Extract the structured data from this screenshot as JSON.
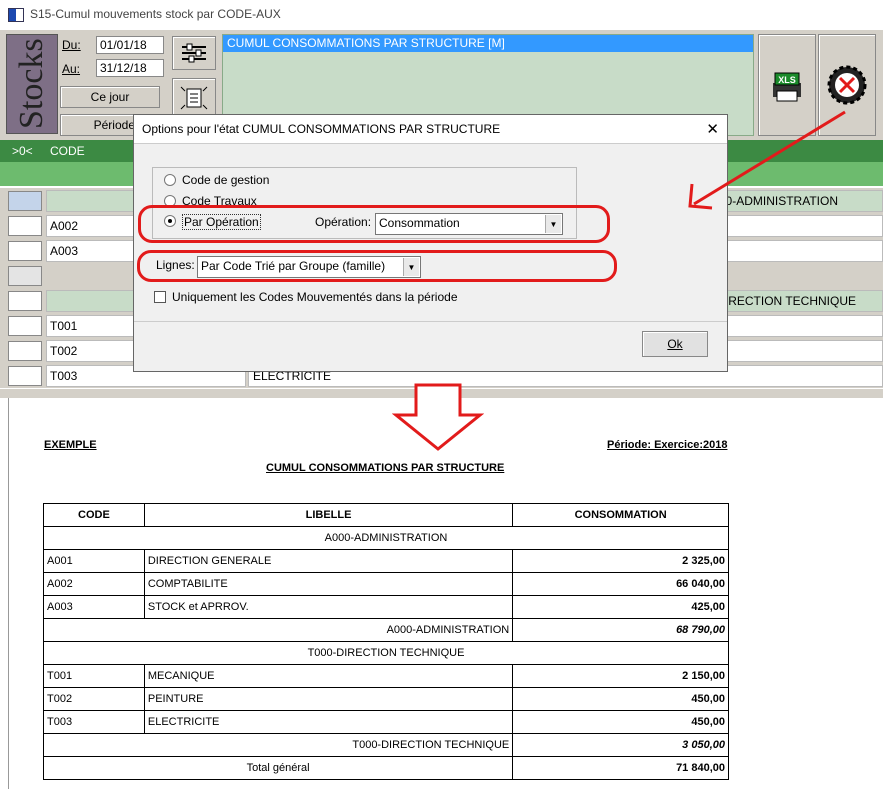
{
  "window": {
    "title": "S15-Cumul mouvements stock par CODE-AUX"
  },
  "toolbar": {
    "stocks_label": "Stocks",
    "du_label": "Du:",
    "du_value": "01/01/18",
    "au_label": "Au:",
    "au_value": "31/12/18",
    "ce_jour": "Ce jour",
    "periode": "Période",
    "selected_state": "CUMUL CONSOMMATIONS PAR STRUCTURE   [M]",
    "xls_label": "XLS"
  },
  "grid": {
    "header_toggle": ">0<",
    "header_code": "CODE",
    "rows": [
      {
        "code": "",
        "libelle": "A000-ADMINISTRATION",
        "group": true
      },
      {
        "code": "A002",
        "libelle": "",
        "group": false
      },
      {
        "code": "A003",
        "libelle": "",
        "group": false
      },
      {
        "code": "",
        "libelle": "",
        "group": false
      },
      {
        "code": "",
        "libelle": "T000-DIRECTION TECHNIQUE",
        "group": true
      },
      {
        "code": "T001",
        "libelle": "",
        "group": false
      },
      {
        "code": "T002",
        "libelle": "",
        "group": false
      },
      {
        "code": "T003",
        "libelle": "ELECTRICITE",
        "group": false
      }
    ]
  },
  "dialog": {
    "title": "Options pour l'état CUMUL CONSOMMATIONS PAR STRUCTURE",
    "close": "✕",
    "radio_gestion": "Code de gestion",
    "radio_travaux": "Code Travaux",
    "radio_operation": "Par Opération",
    "operation_label": "Opération:",
    "operation_value": "Consommation",
    "lignes_label": "Lignes:",
    "lignes_value": "Par Code Trié par Groupe (famille)",
    "checkbox_label": "Uniquement les Codes Mouvementés dans la période",
    "ok": "Ok"
  },
  "report": {
    "exemple": "EXEMPLE",
    "periode": "Période: Exercice:2018",
    "title": "CUMUL CONSOMMATIONS PAR STRUCTURE",
    "headers": [
      "CODE",
      "LIBELLE",
      "CONSOMMATION"
    ],
    "group1": "A000-ADMINISTRATION",
    "group1_rows": [
      {
        "code": "A001",
        "lib": "DIRECTION GENERALE",
        "val": "2  325,00"
      },
      {
        "code": "A002",
        "lib": "COMPTABILITE",
        "val": "66  040,00"
      },
      {
        "code": "A003",
        "lib": "STOCK et APRROV.",
        "val": "425,00"
      }
    ],
    "group1_total_label": "A000-ADMINISTRATION",
    "group1_total": "68 790,00",
    "group2": "T000-DIRECTION TECHNIQUE",
    "group2_rows": [
      {
        "code": "T001",
        "lib": "MECANIQUE",
        "val": "2  150,00"
      },
      {
        "code": "T002",
        "lib": "PEINTURE",
        "val": "450,00"
      },
      {
        "code": "T003",
        "lib": "ELECTRICITE",
        "val": "450,00"
      }
    ],
    "group2_total_label": "T000-DIRECTION TECHNIQUE",
    "group2_total": "3 050,00",
    "grand_total_label": "Total général",
    "grand_total": "71  840,00"
  },
  "colors": {
    "annotation": "#e21b1b",
    "selection": "#3399ff",
    "header_green": "#3c8a43"
  }
}
